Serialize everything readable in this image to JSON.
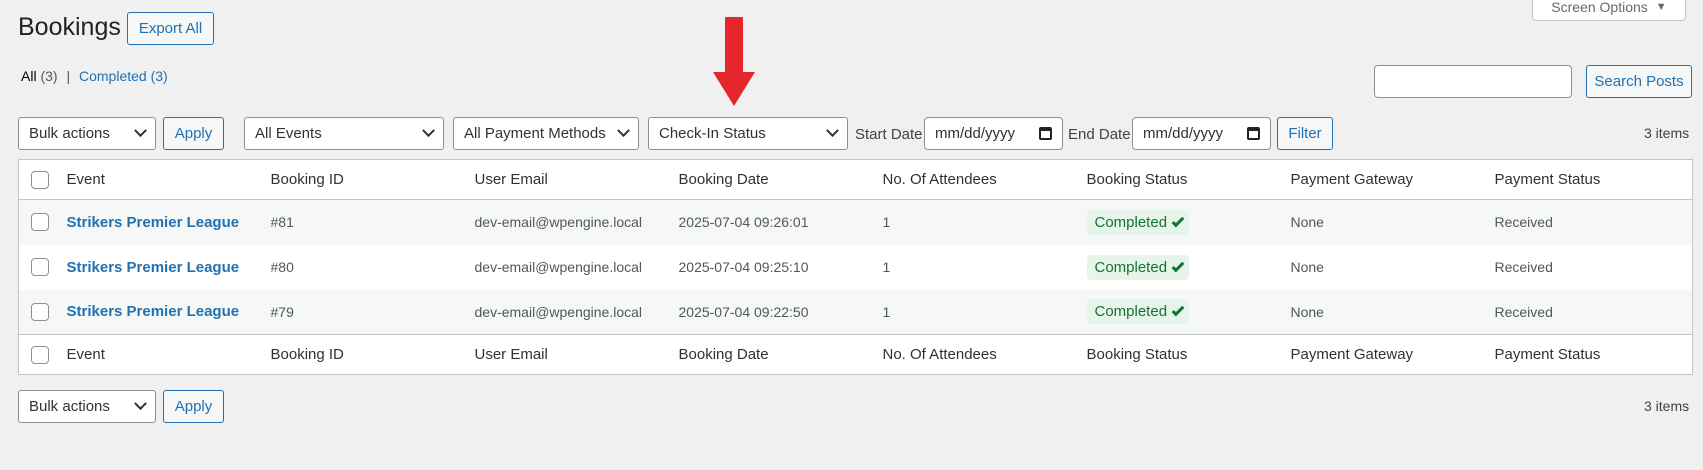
{
  "page": {
    "title": "Bookings",
    "export_label": "Export All",
    "screen_options_label": "Screen Options"
  },
  "views": {
    "all_label": "All",
    "all_count": "(3)",
    "separator": "|",
    "completed_label": "Completed",
    "completed_count": "(3)"
  },
  "search": {
    "value": "",
    "button_label": "Search Posts"
  },
  "filters": {
    "bulk_actions": "Bulk actions",
    "apply_label": "Apply",
    "events": "All Events",
    "payment_methods": "All Payment Methods",
    "checkin_status": "Check-In Status",
    "start_date_label": "Start Date",
    "start_date_placeholder": "mm/dd/yyyy",
    "end_date_label": "End Date",
    "end_date_placeholder": "mm/dd/yyyy",
    "filter_label": "Filter",
    "items_count": "3 items"
  },
  "table": {
    "columns": [
      "Event",
      "Booking ID",
      "User Email",
      "Booking Date",
      "No. Of Attendees",
      "Booking Status",
      "Payment Gateway",
      "Payment Status"
    ],
    "rows": [
      {
        "event": "Strikers Premier League",
        "id": "#81",
        "email": "dev-email@wpengine.local",
        "date": "2025-07-04 09:26:01",
        "attendees": "1",
        "status": "Completed",
        "gateway": "None",
        "payment": "Received"
      },
      {
        "event": "Strikers Premier League",
        "id": "#80",
        "email": "dev-email@wpengine.local",
        "date": "2025-07-04 09:25:10",
        "attendees": "1",
        "status": "Completed",
        "gateway": "None",
        "payment": "Received"
      },
      {
        "event": "Strikers Premier League",
        "id": "#79",
        "email": "dev-email@wpengine.local",
        "date": "2025-07-04 09:22:50",
        "attendees": "1",
        "status": "Completed",
        "gateway": "None",
        "payment": "Received"
      }
    ]
  },
  "bottom": {
    "bulk_actions": "Bulk actions",
    "apply_label": "Apply",
    "items_count": "3 items"
  },
  "colors": {
    "accent": "#2271b1",
    "annotation_arrow": "#e5272d",
    "status_badge_bg": "#e6f4ea",
    "status_badge_text": "#137333"
  }
}
